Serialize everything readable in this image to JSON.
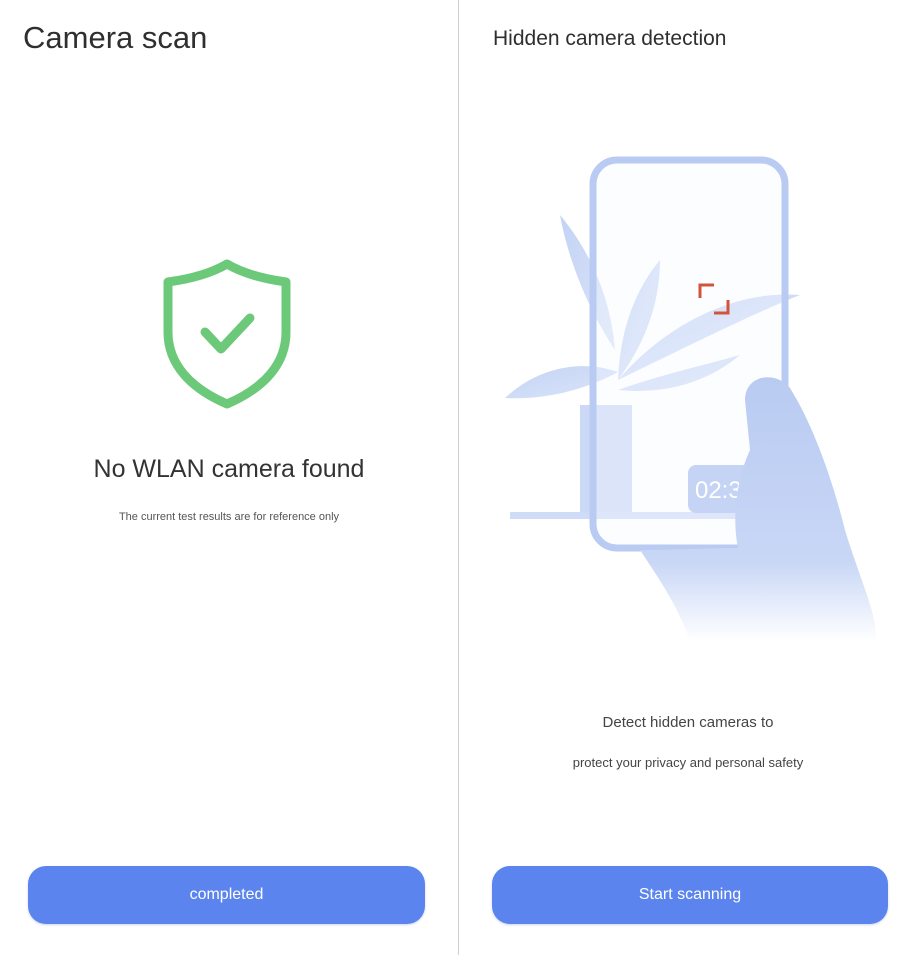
{
  "left": {
    "title": "Camera scan",
    "result_title": "No WLAN camera found",
    "result_note": "The current test results are for reference only",
    "button_label": "completed",
    "icon": "shield-check-icon"
  },
  "right": {
    "title": "Hidden camera detection",
    "illustration_time": "02:36",
    "description_line1": "Detect hidden cameras to",
    "description_line2": "protect your privacy and personal safety",
    "button_label": "Start scanning",
    "illustration": "hand-holding-phone-icon"
  },
  "colors": {
    "accent": "#5b84ee",
    "shield_green": "#6dc97a",
    "scan_frame": "#d2553b",
    "illustration_blue": "#b9cbf2"
  }
}
